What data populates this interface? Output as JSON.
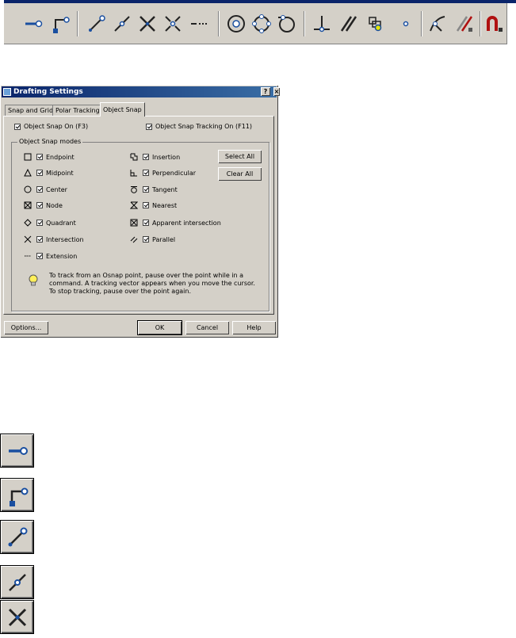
{
  "toolbar": {
    "icons": [
      "temporary-tracking-point-icon",
      "snap-from-icon",
      "snap-to-endpoint-icon",
      "snap-to-midpoint-icon",
      "snap-to-intersection-icon",
      "snap-to-apparent-intersection-icon",
      "snap-to-extension-icon",
      "snap-to-center-icon",
      "snap-to-quadrant-icon",
      "snap-to-tangent-icon",
      "snap-to-perpendicular-icon",
      "snap-to-parallel-icon",
      "snap-to-insert-icon",
      "snap-to-node-icon",
      "snap-to-nearest-icon",
      "snap-to-none-icon",
      "osnap-settings-icon"
    ]
  },
  "dialog": {
    "title": "Drafting Settings",
    "help_glyph": "?",
    "close_glyph": "×",
    "tabs": [
      "Snap and Grid",
      "Polar Tracking",
      "Object Snap"
    ],
    "active_tab": "Object Snap",
    "osnap_on_label": "Object Snap On (F3)",
    "tracking_on_label": "Object Snap Tracking On (F11)",
    "modes_group_label": "Object Snap modes",
    "left_modes": [
      "Endpoint",
      "Midpoint",
      "Center",
      "Node",
      "Quadrant",
      "Intersection",
      "Extension"
    ],
    "right_modes": [
      "Insertion",
      "Perpendicular",
      "Tangent",
      "Nearest",
      "Apparent intersection",
      "Parallel"
    ],
    "select_all_label": "Select All",
    "clear_all_label": "Clear All",
    "hint_line1": "To track from an Osnap point, pause over the point while in a",
    "hint_line2": "command.  A tracking vector appears when you move the cursor.",
    "hint_line3": "To stop tracking, pause over the point again.",
    "options_label": "Options...",
    "ok_label": "OK",
    "cancel_label": "Cancel",
    "help_label": "Help"
  },
  "big_buttons": [
    "temporary-tracking-point-icon",
    "snap-from-icon",
    "snap-to-endpoint-icon",
    "snap-to-midpoint-icon",
    "snap-to-intersection-icon"
  ],
  "colors": {
    "face": "#d4d0c8",
    "title": "#0a246a",
    "icon_blue": "#1a5fb4",
    "icon_red": "#b01010"
  }
}
